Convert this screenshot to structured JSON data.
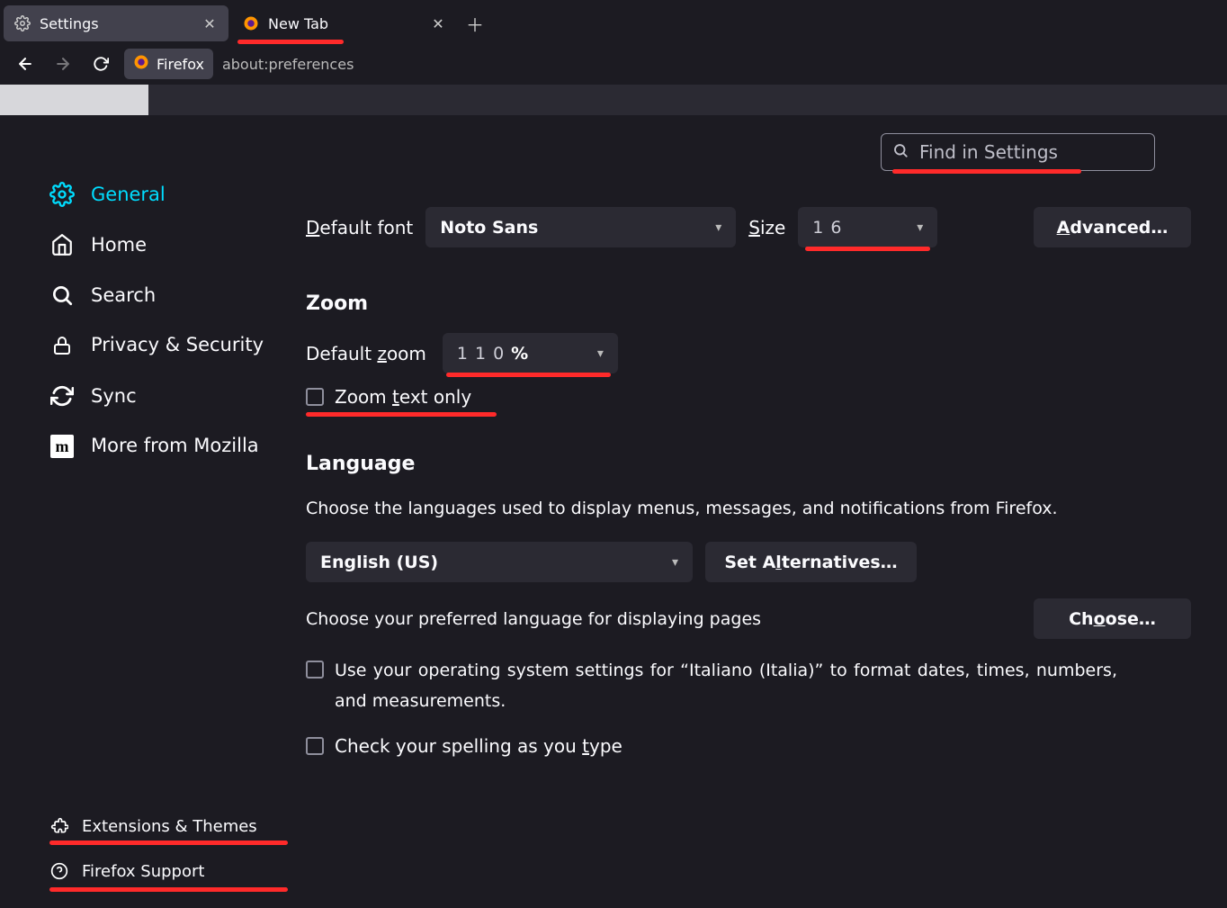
{
  "tabs": [
    {
      "title": "Settings",
      "active": true
    },
    {
      "title": "New Tab",
      "active": false
    }
  ],
  "urlbar": {
    "identity": "Firefox",
    "url": "about:preferences"
  },
  "search": {
    "placeholder": "Find in Settings"
  },
  "sidebar": {
    "items": [
      {
        "label": "General"
      },
      {
        "label": "Home"
      },
      {
        "label": "Search"
      },
      {
        "label": "Privacy & Security"
      },
      {
        "label": "Sync"
      },
      {
        "label": "More from Mozilla"
      }
    ],
    "bottom": [
      {
        "label": "Extensions & Themes"
      },
      {
        "label": "Firefox Support"
      }
    ]
  },
  "fonts": {
    "default_label_pre": "D",
    "default_label_post": "efault font",
    "font_value": "Noto Sans",
    "size_label_pre": "S",
    "size_label_post": "ize",
    "size_value": "16",
    "advanced_pre": "A",
    "advanced_post": "dvanced…"
  },
  "zoom": {
    "heading": "Zoom",
    "default_label_pre": "Default ",
    "default_label_u": "z",
    "default_label_post": "oom",
    "value": "110%",
    "text_only_pre": "Zoom ",
    "text_only_u": "t",
    "text_only_post": "ext only"
  },
  "language": {
    "heading": "Language",
    "desc1": "Choose the languages used to display menus, messages, and notifications from Firefox.",
    "lang_value": "English (US)",
    "set_alt_pre": "Set A",
    "set_alt_u": "l",
    "set_alt_post": "ternatives…",
    "desc2": "Choose your preferred language for displaying pages",
    "choose_pre": "Ch",
    "choose_u": "o",
    "choose_post": "ose…",
    "os_format": "Use your operating system settings for “Italiano (Italia)” to format dates, times, numbers, and measurements.",
    "spell_pre": "Check your spelling as you ",
    "spell_u": "t",
    "spell_post": "ype"
  }
}
